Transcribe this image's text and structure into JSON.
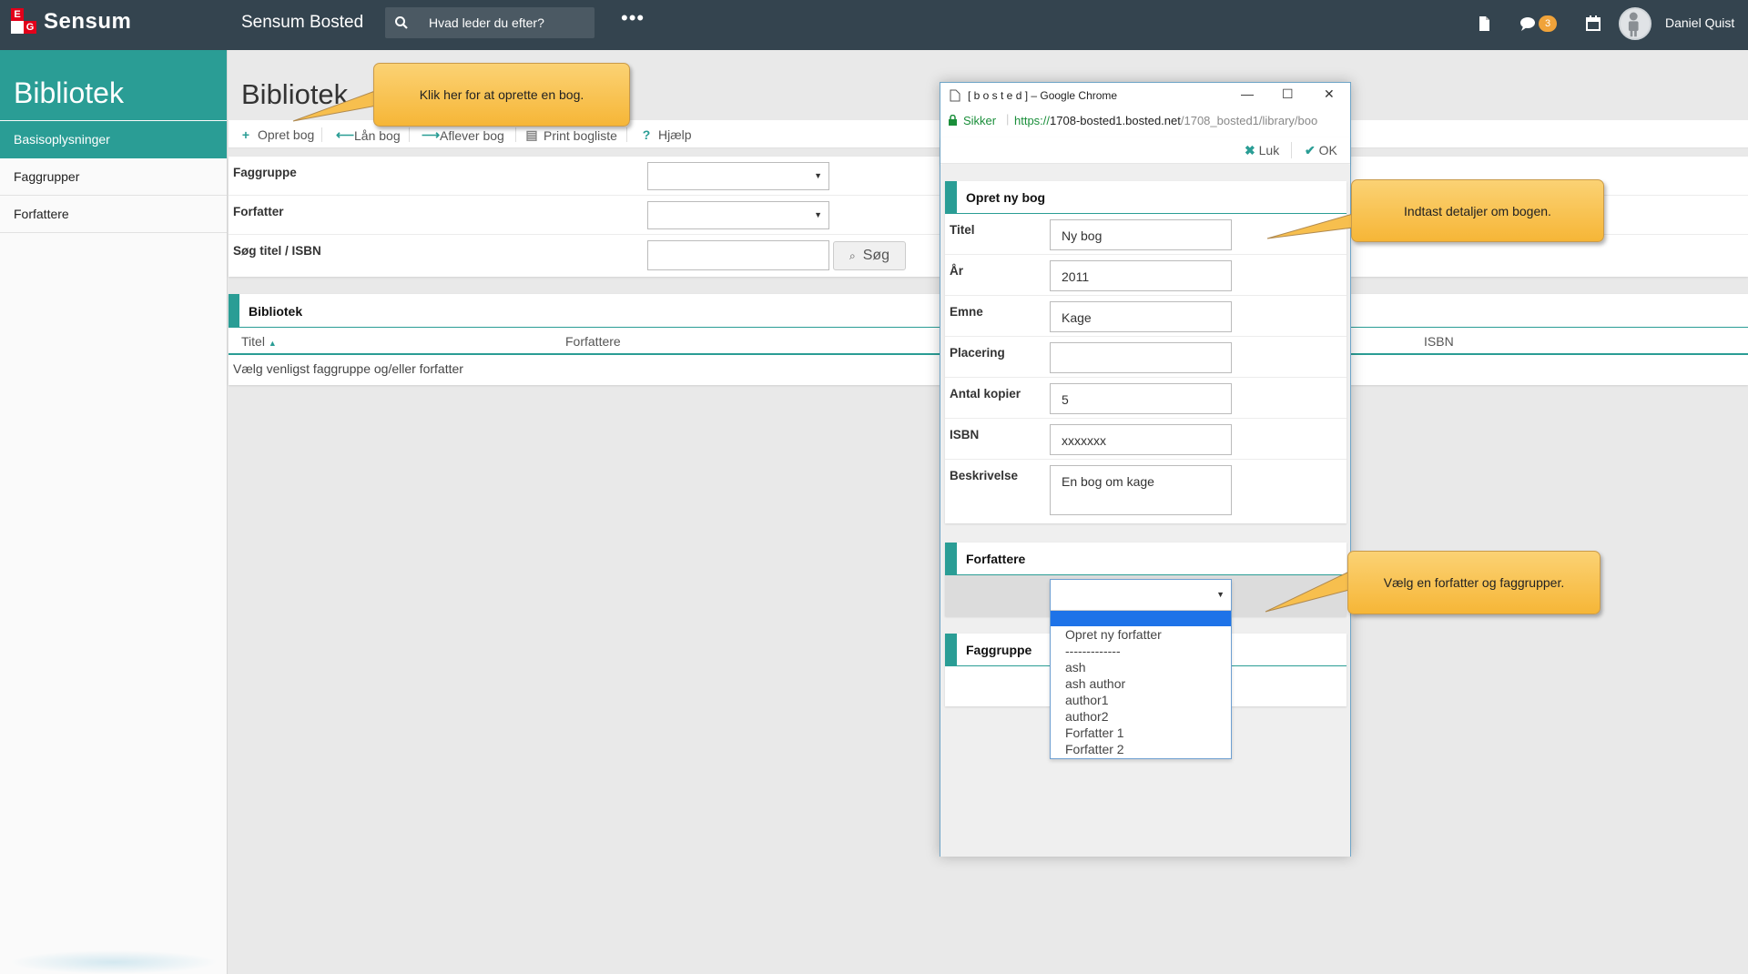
{
  "topbar": {
    "logo_text": "Sensum",
    "logo_letters": [
      "E",
      "G"
    ],
    "app_title": "Sensum Bosted",
    "search_placeholder": "Hvad leder du efter?",
    "more_label": "•••",
    "notification_count": "3",
    "user_name": "Daniel Quist"
  },
  "sidebar": {
    "title": "Bibliotek",
    "items": [
      {
        "label": "Basisoplysninger",
        "active": true
      },
      {
        "label": "Faggrupper",
        "active": false
      },
      {
        "label": "Forfattere",
        "active": false
      }
    ]
  },
  "main": {
    "page_title": "Bibliotek",
    "toolbar": {
      "create": "Opret bog",
      "lend": "Lån bog",
      "return": "Aflever bog",
      "print": "Print bogliste",
      "help": "Hjælp"
    },
    "filters": {
      "faggruppe_label": "Faggruppe",
      "forfatter_label": "Forfatter",
      "search_label": "Søg titel / ISBN",
      "search_button": "Søg"
    },
    "library": {
      "title": "Bibliotek",
      "columns": [
        "Titel",
        "Forfattere",
        "ISBN"
      ],
      "empty_text": "Vælg venligst faggruppe og/eller forfatter"
    }
  },
  "popup": {
    "window_title": "[ b o s t e d ] – Google Chrome",
    "secure_label": "Sikker",
    "url_prefix": "https://",
    "url_host": "1708-bosted1.bosted.net",
    "url_path": "/1708_bosted1/library/boo",
    "close_label": "Luk",
    "ok_label": "OK",
    "form": {
      "title": "Opret ny bog",
      "fields": [
        {
          "label": "Titel",
          "value": "Ny bog"
        },
        {
          "label": "År",
          "value": "2011"
        },
        {
          "label": "Emne",
          "value": "Kage"
        },
        {
          "label": "Placering",
          "value": ""
        },
        {
          "label": "Antal kopier",
          "value": "5"
        },
        {
          "label": "ISBN",
          "value": "xxxxxxx"
        }
      ],
      "description_label": "Beskrivelse",
      "description_value": "En bog om kage"
    },
    "authors": {
      "title": "Forfattere",
      "options": [
        "Opret ny forfatter",
        "-------------",
        "ash",
        "ash author",
        "author1",
        "author2",
        "Forfatter 1",
        "Forfatter 2"
      ]
    },
    "faggruppe": {
      "title": "Faggruppe"
    }
  },
  "callouts": {
    "create": "Klik her for at oprette en bog.",
    "details": "Indtast detaljer om bogen.",
    "author": "Vælg en forfatter og faggrupper."
  },
  "colors": {
    "topbar": "#34444f",
    "accent": "#2a9d95",
    "callout": "#f6b637",
    "badge": "#f0a33a",
    "dropdown_selected": "#1e73e8"
  }
}
